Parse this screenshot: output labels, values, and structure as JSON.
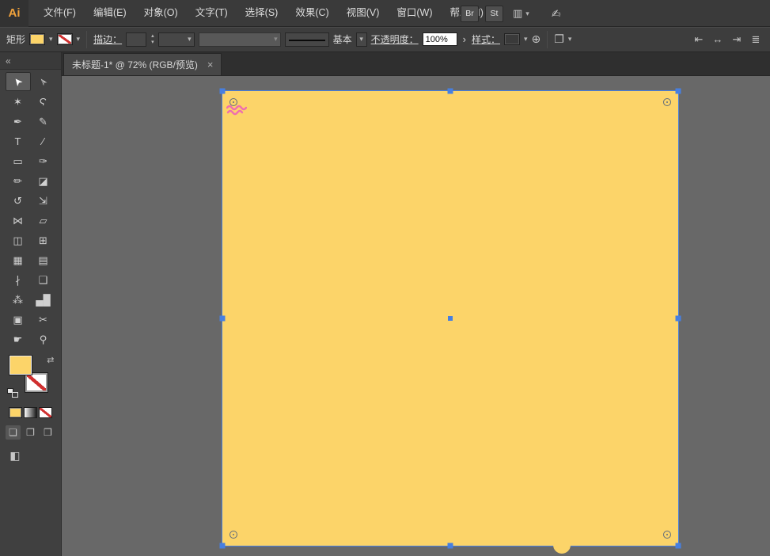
{
  "app": {
    "logo": "Ai",
    "menus": [
      "文件(F)",
      "编辑(E)",
      "对象(O)",
      "文字(T)",
      "选择(S)",
      "效果(C)",
      "视图(V)",
      "窗口(W)",
      "帮助(H)"
    ],
    "bridge_label": "Br",
    "stock_label": "St",
    "workspace_icon": "▥",
    "chevron": "▾",
    "pen_icon": "✍"
  },
  "control_bar": {
    "shape_label": "矩形",
    "chevron": "▾",
    "spin_up": "▴",
    "spin_down": "▾",
    "stroke_label": "描边：",
    "brush_label": "基本",
    "opacity_label": "不透明度：",
    "opacity_value": "100%",
    "opacity_expand": "›",
    "style_label": "样式：",
    "globe_icon": "⊕",
    "arrange_icon": "❐",
    "align_icons": [
      {
        "name": "align-left-button",
        "glyph": "⇤"
      },
      {
        "name": "align-center-button",
        "glyph": "↔"
      },
      {
        "name": "align-right-button",
        "glyph": "⇥"
      },
      {
        "name": "distribute-button",
        "glyph": "≣"
      }
    ]
  },
  "document_tab": {
    "title": "未标题-1* @ 72% (RGB/预览)",
    "close_icon": "×"
  },
  "tools": {
    "collapse_icon": "«",
    "swap_icon": "⇄",
    "items": [
      {
        "name": "selection-tool",
        "glyph": "➤",
        "rot": true,
        "selected": true
      },
      {
        "name": "direct-selection-tool",
        "glyph": "➢",
        "rot": true
      },
      {
        "name": "magic-wand-tool",
        "glyph": "✶"
      },
      {
        "name": "lasso-tool",
        "glyph": "Ϛ"
      },
      {
        "name": "pen-tool",
        "glyph": "✒"
      },
      {
        "name": "curvature-tool",
        "glyph": "✎"
      },
      {
        "name": "type-tool",
        "glyph": "T"
      },
      {
        "name": "line-segment-tool",
        "glyph": "∕"
      },
      {
        "name": "rectangle-tool",
        "glyph": "▭"
      },
      {
        "name": "paintbrush-tool",
        "glyph": "✑"
      },
      {
        "name": "pencil-tool",
        "glyph": "✏"
      },
      {
        "name": "eraser-tool",
        "glyph": "◪"
      },
      {
        "name": "rotate-tool",
        "glyph": "↺"
      },
      {
        "name": "scale-tool",
        "glyph": "⇲"
      },
      {
        "name": "width-tool",
        "glyph": "⋈"
      },
      {
        "name": "free-transform-tool",
        "glyph": "▱"
      },
      {
        "name": "shape-builder-tool",
        "glyph": "◫"
      },
      {
        "name": "perspective-grid-tool",
        "glyph": "⊞"
      },
      {
        "name": "mesh-tool",
        "glyph": "▦"
      },
      {
        "name": "gradient-tool",
        "glyph": "▤"
      },
      {
        "name": "eyedropper-tool",
        "glyph": "∤"
      },
      {
        "name": "blend-tool",
        "glyph": "❑"
      },
      {
        "name": "symbol-sprayer-tool",
        "glyph": "⁂"
      },
      {
        "name": "column-graph-tool",
        "glyph": "▄█"
      },
      {
        "name": "artboard-tool",
        "glyph": "▣"
      },
      {
        "name": "slice-tool",
        "glyph": "✂"
      },
      {
        "name": "hand-tool",
        "glyph": "☛"
      },
      {
        "name": "zoom-tool",
        "glyph": "⚲"
      }
    ],
    "draw_modes": [
      {
        "name": "draw-normal-mode-button",
        "glyph": "❏"
      },
      {
        "name": "draw-behind-mode-button",
        "glyph": "❐"
      },
      {
        "name": "draw-inside-mode-button",
        "glyph": "❒"
      }
    ],
    "screen_mode_icon": "◧"
  },
  "canvas": {
    "artboard_fill": "#fcd469",
    "selection_color": "#477fe0",
    "scribble_color": "#ee6fae"
  }
}
